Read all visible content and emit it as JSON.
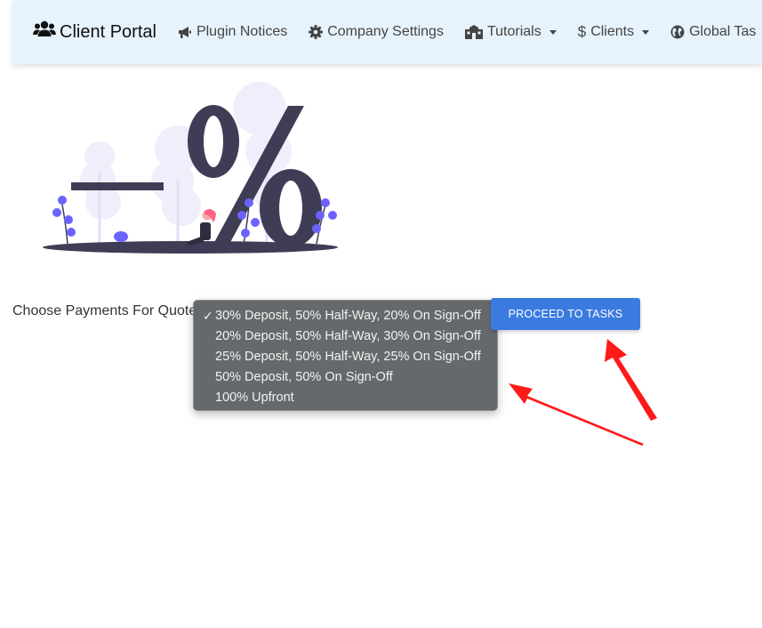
{
  "navbar": {
    "brand": "Client Portal",
    "items": [
      {
        "label": "Plugin Notices",
        "icon": "megaphone-icon",
        "dropdown": false
      },
      {
        "label": "Company Settings",
        "icon": "gear-icon",
        "dropdown": false
      },
      {
        "label": "Tutorials",
        "icon": "school-icon",
        "dropdown": true
      },
      {
        "label": "Clients",
        "icon": "dollar-icon",
        "dropdown": true
      },
      {
        "label": "Global Tas",
        "icon": "globe-icon",
        "dropdown": false
      }
    ]
  },
  "form": {
    "label": "Choose Payments For Quote",
    "options": [
      "30% Deposit, 50% Half-Way, 20% On Sign-Off",
      "20% Deposit, 50% Half-Way, 30% On Sign-Off",
      "25% Deposit, 50% Half-Way, 25% On Sign-Off",
      "50% Deposit, 50% On Sign-Off",
      "100% Upfront"
    ],
    "selected_index": 0,
    "check_mark": "✓",
    "proceed_label": "PROCEED TO TASKS"
  },
  "colors": {
    "navbar_bg": "#e6f2fc",
    "button_bg": "#3b7be0",
    "arrow": "#ff1a1a",
    "illustration_dark": "#3f3d56",
    "illustration_accent": "#6c63ff"
  }
}
